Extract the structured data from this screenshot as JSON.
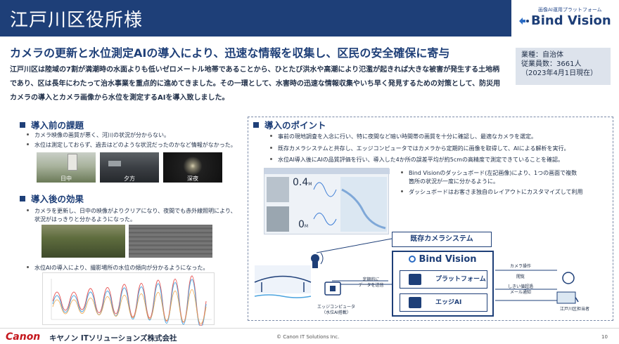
{
  "header": {
    "title": "江戸川区役所様",
    "logo_subtitle": "画像AI運用プラットフォーム",
    "logo_name": "Bind Vision"
  },
  "headline": "カメラの更新と水位測定AIの導入により、迅速な情報を収集し、区民の安全確保に寄与",
  "intro": "江戸川区は陸域の7割が満潮時の水面よりも低いゼロメートル地帯であることから、ひとたび洪水や高潮により氾濫が起きれば大きな被害が発生する土地柄であり、区は長年にわたって治水事業を重点的に進めてきました。その一環として、水害時の迅速な情報収集やいち早く発見するための対策として、防災用カメラの導入とカメラ画像から水位を測定するAIを導入致しました。",
  "info_box": {
    "industry": "業種：自治体",
    "employees": "従業員数：3661人",
    "as_of": "（2023年4月1日現在）"
  },
  "before": {
    "title": "導入前の課題",
    "bullets": [
      "カメラ映像の画質が悪く、河川の状況が分からない。",
      "水位は測定しておらず、過去はどのような状況だったのかなど情報がなかった。"
    ],
    "photos": [
      "日中",
      "夕方",
      "深夜"
    ]
  },
  "after": {
    "title": "導入後の効果",
    "bullet1_line1": "カメラを更新し、日中の映像がよりクリアになり、夜間でも赤外線照明により、",
    "bullet1_line2": "状況がはっきりと分かるようになった。",
    "bullet2": "水位AIの導入により、撮影場所の水位の傾向が分かるようになった。"
  },
  "points": {
    "title": "導入のポイント",
    "bullets": [
      "事前の現地調査を入念に行い、特に夜間など暗い時間帯の画質を十分に確認し、最適なカメラを選定。",
      "既存カメラシステムと共存し、エッジコンピュータではカメラから定期的に画像を取得して、AIによる解析を実行。",
      "水位AI導入後にAIの品質評価を行い、導入した4か所の誤差平均が約5cmの高精度で測定できていることを確認。"
    ],
    "sub_bullet1_line1": "Bind Visionのダッシュボード(左記画像)により、1つの画面で複数",
    "sub_bullet1_line2": "箇所の状況が一度に分かるように。",
    "sub_bullet2": "ダッシュボードはお客さま独自のレイアウトにカスタマイズして利用"
  },
  "dashboard": {
    "value_top": "0.4",
    "value_bottom": "0",
    "unit": "M"
  },
  "diagram": {
    "existing_camera": "既存カメラシステム",
    "bv_title": "Bind Vision",
    "platform": "プラットフォーム",
    "edge_ai": "エッジAI",
    "edge_computer": "エッジコンピュータ",
    "edge_computer_note": "（水位AI搭載）",
    "periodic_send_line1": "定期的に",
    "periodic_send_line2": "データを送信",
    "camera_op": "カメラ操作",
    "browse": "閲覧",
    "threshold_line1": "しきい値超過",
    "threshold_line2": "メール通知",
    "staff": "江戸川区担当者"
  },
  "footer": {
    "canon": "Canon",
    "company": "キヤノン ITソリューションズ株式会社",
    "copyright": "© Canon IT Solutions Inc.",
    "page": "10"
  },
  "colors": {
    "brand_navy": "#1e3f78",
    "canon_red": "#c4161c"
  }
}
